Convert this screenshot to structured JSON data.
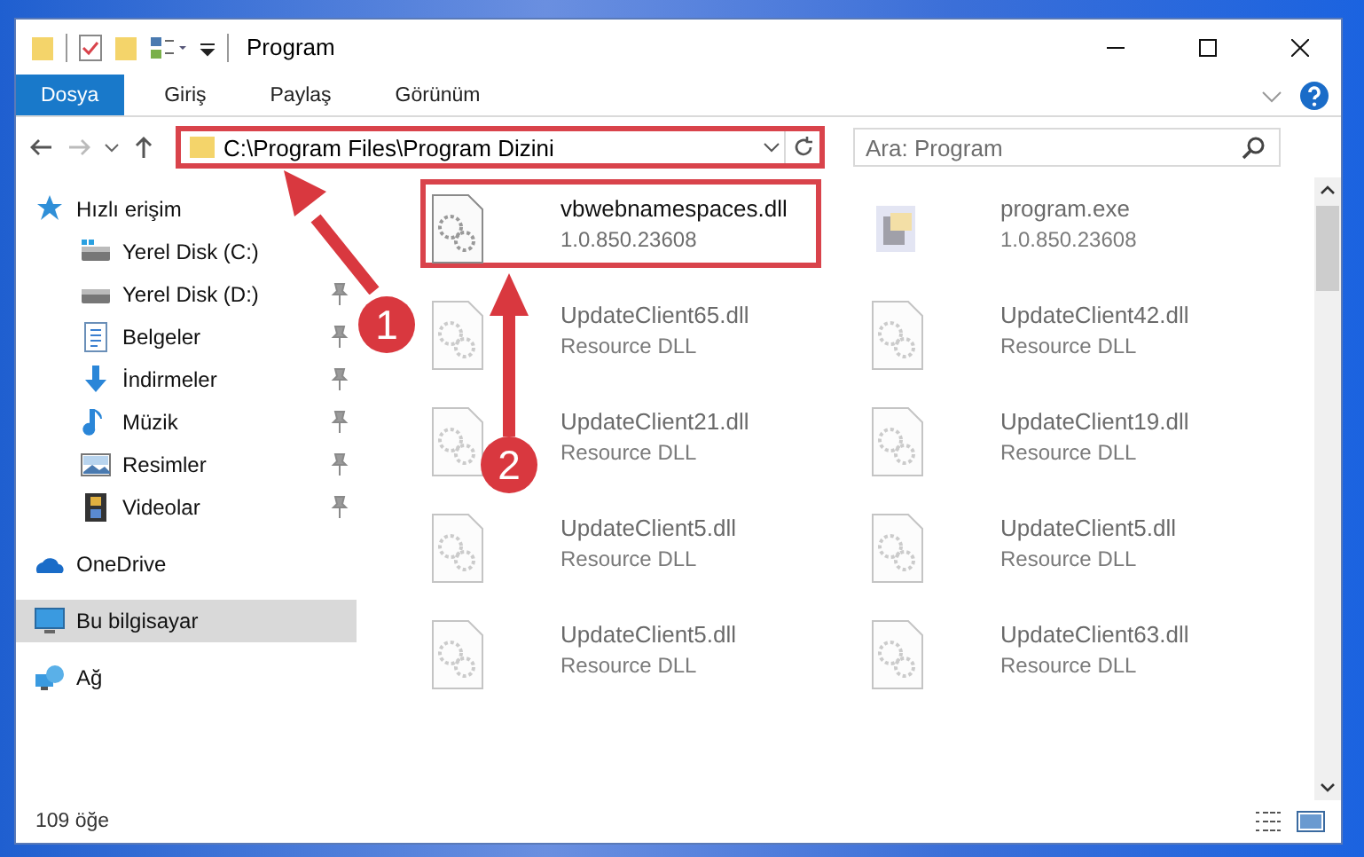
{
  "window": {
    "title": "Program"
  },
  "ribbon_tabs": [
    {
      "label": "Dosya",
      "selected": true
    },
    {
      "label": "Giriş",
      "selected": false
    },
    {
      "label": "Paylaş",
      "selected": false
    },
    {
      "label": "Görünüm",
      "selected": false
    }
  ],
  "address_bar": {
    "path": "C:\\Program Files\\Program Dizini",
    "highlighted": true
  },
  "search": {
    "placeholder": "Ara: Program"
  },
  "sidebar": {
    "items": [
      {
        "label": "Hızlı erişim",
        "kind": "quick",
        "pinned": false,
        "selected": false,
        "children": [
          {
            "label": "Yerel Disk (C:)",
            "kind": "drive-c",
            "pinned": false,
            "selected": false
          },
          {
            "label": "Yerel Disk (D:)",
            "kind": "drive",
            "pinned": true,
            "selected": false
          },
          {
            "label": "Belgeler",
            "kind": "docs",
            "pinned": true,
            "selected": false
          },
          {
            "label": "İndirmeler",
            "kind": "download",
            "pinned": true,
            "selected": false
          },
          {
            "label": "Müzik",
            "kind": "music",
            "pinned": true,
            "selected": false
          },
          {
            "label": "Resimler",
            "kind": "pictures",
            "pinned": true,
            "selected": false
          },
          {
            "label": "Videolar",
            "kind": "videos",
            "pinned": true,
            "selected": false
          }
        ]
      },
      {
        "label": "OneDrive",
        "kind": "cloud",
        "pinned": false,
        "selected": false
      },
      {
        "label": "Bu bilgisayar",
        "kind": "pc",
        "pinned": false,
        "selected": true
      },
      {
        "label": "Ağ",
        "kind": "network",
        "pinned": false,
        "selected": false
      }
    ]
  },
  "files": [
    {
      "name": "vbwebnamespaces.dll",
      "detail": "1.0.850.23608",
      "kind": "dll",
      "highlighted": true,
      "faded": false
    },
    {
      "name": "program.exe",
      "detail": "1.0.850.23608",
      "kind": "exe",
      "highlighted": false,
      "faded": true
    },
    {
      "name": "UpdateClient65.dll",
      "detail": "Resource DLL",
      "kind": "dll",
      "highlighted": false,
      "faded": true
    },
    {
      "name": "UpdateClient42.dll",
      "detail": "Resource DLL",
      "kind": "dll",
      "highlighted": false,
      "faded": true
    },
    {
      "name": "UpdateClient21.dll",
      "detail": "Resource DLL",
      "kind": "dll",
      "highlighted": false,
      "faded": true
    },
    {
      "name": "UpdateClient19.dll",
      "detail": "Resource DLL",
      "kind": "dll",
      "highlighted": false,
      "faded": true
    },
    {
      "name": "UpdateClient5.dll",
      "detail": "Resource DLL",
      "kind": "dll",
      "highlighted": false,
      "faded": true
    },
    {
      "name": "UpdateClient5.dll",
      "detail": "Resource DLL",
      "kind": "dll",
      "highlighted": false,
      "faded": true
    },
    {
      "name": "UpdateClient5.dll",
      "detail": "Resource DLL",
      "kind": "dll",
      "highlighted": false,
      "faded": true
    },
    {
      "name": "UpdateClient63.dll",
      "detail": "Resource DLL",
      "kind": "dll",
      "highlighted": false,
      "faded": true
    }
  ],
  "status_bar": {
    "count": "109 öğe"
  },
  "annotations": [
    {
      "label": "1"
    },
    {
      "label": "2"
    }
  ]
}
